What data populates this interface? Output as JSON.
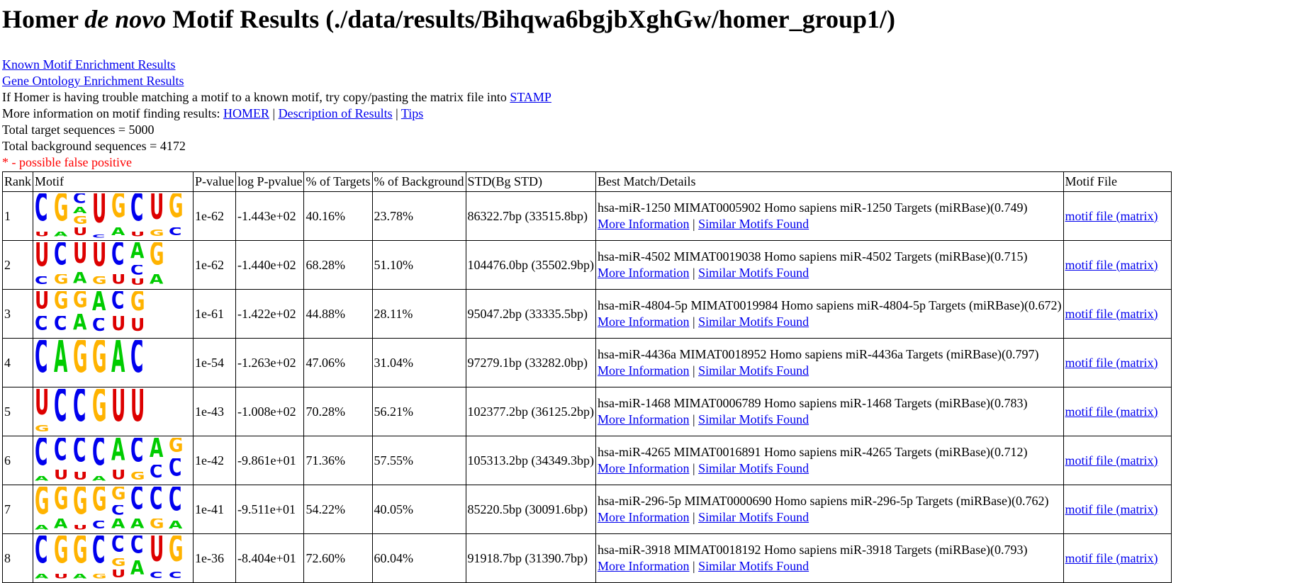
{
  "page": {
    "title_prefix": "Homer ",
    "title_italic": "de novo",
    "title_suffix": " Motif Results (./data/results/Bihqwa6bgjbXghGw/homer_group1/)"
  },
  "links": {
    "known_motif": "Known Motif Enrichment Results",
    "gene_ontology": "Gene Ontology Enrichment Results",
    "stamp_text": "If Homer is having trouble matching a motif to a known motif, try copy/pasting the matrix file into ",
    "stamp_link": "STAMP",
    "more_info_text": "More information on motif finding results: ",
    "homer": "HOMER",
    "description": "Description of Results",
    "tips": "Tips",
    "sep": " | "
  },
  "stats": {
    "target": "Total target sequences = 5000",
    "background": "Total background sequences = 4172",
    "false_positive": "* - possible false positive"
  },
  "colors": {
    "A": "#00cc00",
    "C": "#0000ee",
    "G": "#ffb300",
    "U": "#dd0000"
  },
  "table": {
    "headers": [
      "Rank",
      "Motif",
      "P-value",
      "log P-pvalue",
      "% of Targets",
      "% of Background",
      "STD(Bg STD)",
      "Best Match/Details",
      "Motif File"
    ],
    "more_info": "More Information",
    "similar": "Similar Motifs Found",
    "motif_file": "motif file (matrix)",
    "rows": [
      {
        "rank": "1",
        "pvalue": "1e-62",
        "logp": "-1.443e+02",
        "targets": "40.16%",
        "background": "23.78%",
        "std": "86322.7bp (33515.8bp)",
        "match": "hsa-miR-1250 MIMAT0005902 Homo sapiens miR-1250 Targets (miRBase)(0.749)",
        "logo": [
          [
            [
              "C",
              0.85
            ],
            [
              "U",
              0.15
            ]
          ],
          [
            [
              "G",
              0.85
            ],
            [
              "A",
              0.15
            ]
          ],
          [
            [
              "C",
              0.3
            ],
            [
              "A",
              0.2
            ],
            [
              "G",
              0.25
            ],
            [
              "U",
              0.25
            ]
          ],
          [
            [
              "U",
              0.9
            ],
            [
              "C",
              0.1
            ]
          ],
          [
            [
              "G",
              0.75
            ],
            [
              "A",
              0.25
            ]
          ],
          [
            [
              "C",
              0.85
            ],
            [
              "U",
              0.15
            ]
          ],
          [
            [
              "U",
              0.8
            ],
            [
              "G",
              0.2
            ]
          ],
          [
            [
              "G",
              0.75
            ],
            [
              "C",
              0.25
            ]
          ]
        ]
      },
      {
        "rank": "2",
        "pvalue": "1e-62",
        "logp": "-1.440e+02",
        "targets": "68.28%",
        "background": "51.10%",
        "std": "104476.0bp (35502.9bp)",
        "match": "hsa-miR-4502 MIMAT0019038 Homo sapiens miR-4502 Targets (miRBase)(0.715)",
        "logo": [
          [
            [
              "U",
              0.75
            ],
            [
              "C",
              0.25
            ]
          ],
          [
            [
              "C",
              0.7
            ],
            [
              "G",
              0.3
            ]
          ],
          [
            [
              "U",
              0.65
            ],
            [
              "A",
              0.35
            ]
          ],
          [
            [
              "U",
              0.75
            ],
            [
              "G",
              0.25
            ]
          ],
          [
            [
              "C",
              0.7
            ],
            [
              "U",
              0.3
            ]
          ],
          [
            [
              "A",
              0.5
            ],
            [
              "C",
              0.3
            ],
            [
              "U",
              0.2
            ]
          ],
          [
            [
              "G",
              0.7
            ],
            [
              "A",
              0.3
            ]
          ]
        ]
      },
      {
        "rank": "3",
        "pvalue": "1e-61",
        "logp": "-1.422e+02",
        "targets": "44.88%",
        "background": "28.11%",
        "std": "95047.2bp (33335.5bp)",
        "match": "hsa-miR-4804-5p MIMAT0019984 Homo sapiens miR-4804-5p Targets (miRBase)(0.672)",
        "logo": [
          [
            [
              "U",
              0.55
            ],
            [
              "C",
              0.45
            ]
          ],
          [
            [
              "G",
              0.55
            ],
            [
              "C",
              0.45
            ]
          ],
          [
            [
              "G",
              0.5
            ],
            [
              "A",
              0.5
            ]
          ],
          [
            [
              "A",
              0.6
            ],
            [
              "C",
              0.4
            ]
          ],
          [
            [
              "C",
              0.55
            ],
            [
              "U",
              0.45
            ]
          ],
          [
            [
              "G",
              0.6
            ],
            [
              "U",
              0.4
            ]
          ]
        ]
      },
      {
        "rank": "4",
        "pvalue": "1e-54",
        "logp": "-1.263e+02",
        "targets": "47.06%",
        "background": "31.04%",
        "std": "97279.1bp (33282.0bp)",
        "match": "hsa-miR-4436a MIMAT0018952 Homo sapiens miR-4436a Targets (miRBase)(0.797)",
        "logo": [
          [
            [
              "C",
              1.0
            ]
          ],
          [
            [
              "A",
              1.0
            ]
          ],
          [
            [
              "G",
              1.0
            ]
          ],
          [
            [
              "G",
              1.0
            ]
          ],
          [
            [
              "A",
              1.0
            ]
          ],
          [
            [
              "C",
              1.0
            ]
          ]
        ]
      },
      {
        "rank": "5",
        "pvalue": "1e-43",
        "logp": "-1.008e+02",
        "targets": "70.28%",
        "background": "56.21%",
        "std": "102377.2bp (36125.2bp)",
        "match": "hsa-miR-1468 MIMAT0006789 Homo sapiens miR-1468 Targets (miRBase)(0.783)",
        "logo": [
          [
            [
              "U",
              0.8
            ],
            [
              "G",
              0.2
            ]
          ],
          [
            [
              "C",
              1.0
            ]
          ],
          [
            [
              "C",
              1.0
            ]
          ],
          [
            [
              "G",
              1.0
            ]
          ],
          [
            [
              "U",
              1.0
            ]
          ],
          [
            [
              "U",
              1.0
            ]
          ]
        ]
      },
      {
        "rank": "6",
        "pvalue": "1e-42",
        "logp": "-9.861e+01",
        "targets": "71.36%",
        "background": "57.55%",
        "std": "105313.2bp (34349.3bp)",
        "match": "hsa-miR-4265 MIMAT0016891 Homo sapiens miR-4265 Targets (miRBase)(0.712)",
        "logo": [
          [
            [
              "C",
              0.85
            ],
            [
              "A",
              0.15
            ]
          ],
          [
            [
              "C",
              0.7
            ],
            [
              "U",
              0.3
            ]
          ],
          [
            [
              "C",
              0.75
            ],
            [
              "U",
              0.25
            ]
          ],
          [
            [
              "C",
              0.85
            ],
            [
              "A",
              0.15
            ]
          ],
          [
            [
              "A",
              0.7
            ],
            [
              "U",
              0.3
            ]
          ],
          [
            [
              "C",
              0.75
            ],
            [
              "G",
              0.25
            ]
          ],
          [
            [
              "A",
              0.6
            ],
            [
              "C",
              0.4
            ]
          ],
          [
            [
              "G",
              0.45
            ],
            [
              "C",
              0.55
            ]
          ]
        ]
      },
      {
        "rank": "7",
        "pvalue": "1e-41",
        "logp": "-9.511e+01",
        "targets": "54.22%",
        "background": "40.05%",
        "std": "85220.5bp (30091.6bp)",
        "match": "hsa-miR-296-5p MIMAT0000690 Homo sapiens miR-296-5p Targets (miRBase)(0.762)",
        "logo": [
          [
            [
              "G",
              0.85
            ],
            [
              "A",
              0.15
            ]
          ],
          [
            [
              "G",
              0.7
            ],
            [
              "A",
              0.3
            ]
          ],
          [
            [
              "G",
              0.85
            ],
            [
              "U",
              0.15
            ]
          ],
          [
            [
              "G",
              0.75
            ],
            [
              "C",
              0.25
            ]
          ],
          [
            [
              "G",
              0.4
            ],
            [
              "C",
              0.3
            ],
            [
              "A",
              0.3
            ]
          ],
          [
            [
              "C",
              0.7
            ],
            [
              "A",
              0.3
            ]
          ],
          [
            [
              "C",
              0.7
            ],
            [
              "G",
              0.3
            ]
          ],
          [
            [
              "C",
              0.75
            ],
            [
              "A",
              0.25
            ]
          ]
        ]
      },
      {
        "rank": "8",
        "pvalue": "1e-36",
        "logp": "-8.404e+01",
        "targets": "72.60%",
        "background": "60.04%",
        "std": "91918.7bp (31390.7bp)",
        "match": "hsa-miR-3918 MIMAT0018192 Homo sapiens miR-3918 Targets (miRBase)(0.793)",
        "logo": [
          [
            [
              "C",
              0.85
            ],
            [
              "A",
              0.15
            ]
          ],
          [
            [
              "G",
              0.85
            ],
            [
              "U",
              0.15
            ]
          ],
          [
            [
              "G",
              0.85
            ],
            [
              "A",
              0.15
            ]
          ],
          [
            [
              "C",
              0.85
            ],
            [
              "G",
              0.15
            ]
          ],
          [
            [
              "C",
              0.5
            ],
            [
              "G",
              0.25
            ],
            [
              "U",
              0.25
            ]
          ],
          [
            [
              "C",
              0.55
            ],
            [
              "A",
              0.45
            ]
          ],
          [
            [
              "U",
              0.8
            ],
            [
              "C",
              0.2
            ]
          ],
          [
            [
              "G",
              0.8
            ],
            [
              "C",
              0.2
            ]
          ]
        ]
      }
    ]
  }
}
